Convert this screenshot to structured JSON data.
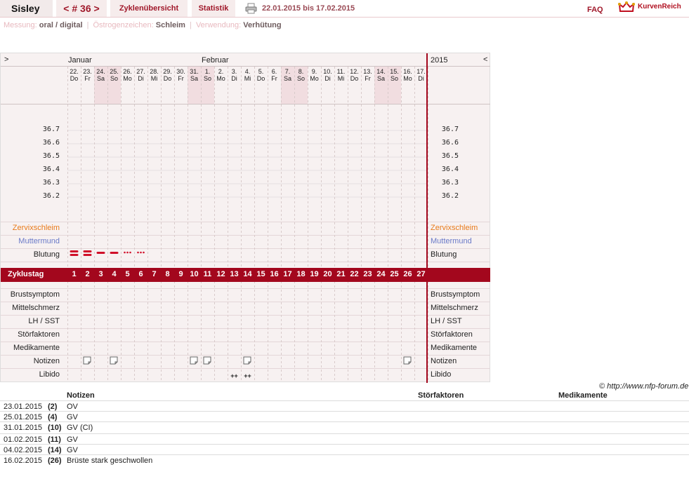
{
  "header": {
    "user": "Sisley",
    "cycle_nav": "< # 36 >",
    "tab_overview": "Zyklenübersicht",
    "tab_stats": "Statistik",
    "date_range": "22.01.2015 bis 17.02.2015",
    "faq": "FAQ",
    "logo_text": "KurvenReich"
  },
  "meta": {
    "messung_label": "Messung:",
    "messung_value": "oral / digital",
    "oestro_label": "Östrogenzeichen:",
    "oestro_value": "Schleim",
    "verwendung_label": "Verwendung:",
    "verwendung_value": "Verhütung"
  },
  "chart": {
    "nav_left": ">",
    "nav_right": "<",
    "year": "2015",
    "month_jan": "Januar",
    "month_feb": "Februar",
    "days": [
      {
        "d": "22.",
        "w": "Do",
        "we": false
      },
      {
        "d": "23.",
        "w": "Fr",
        "we": false
      },
      {
        "d": "24.",
        "w": "Sa",
        "we": true
      },
      {
        "d": "25.",
        "w": "So",
        "we": true
      },
      {
        "d": "26.",
        "w": "Mo",
        "we": false
      },
      {
        "d": "27.",
        "w": "Di",
        "we": false
      },
      {
        "d": "28.",
        "w": "Mi",
        "we": false
      },
      {
        "d": "29.",
        "w": "Do",
        "we": false
      },
      {
        "d": "30.",
        "w": "Fr",
        "we": false
      },
      {
        "d": "31.",
        "w": "Sa",
        "we": true
      },
      {
        "d": "1.",
        "w": "So",
        "we": true
      },
      {
        "d": "2.",
        "w": "Mo",
        "we": false
      },
      {
        "d": "3.",
        "w": "Di",
        "we": false
      },
      {
        "d": "4.",
        "w": "Mi",
        "we": false
      },
      {
        "d": "5.",
        "w": "Do",
        "we": false
      },
      {
        "d": "6.",
        "w": "Fr",
        "we": false
      },
      {
        "d": "7.",
        "w": "Sa",
        "we": true
      },
      {
        "d": "8.",
        "w": "So",
        "we": true
      },
      {
        "d": "9.",
        "w": "Mo",
        "we": false
      },
      {
        "d": "10.",
        "w": "Di",
        "we": false
      },
      {
        "d": "11.",
        "w": "Mi",
        "we": false
      },
      {
        "d": "12.",
        "w": "Do",
        "we": false
      },
      {
        "d": "13.",
        "w": "Fr",
        "we": false
      },
      {
        "d": "14.",
        "w": "Sa",
        "we": true
      },
      {
        "d": "15.",
        "w": "So",
        "we": true
      },
      {
        "d": "16.",
        "w": "Mo",
        "we": false
      },
      {
        "d": "17.",
        "w": "Di",
        "we": false
      }
    ],
    "temps": [
      "36.7",
      "36.6",
      "36.5",
      "36.4",
      "36.3",
      "36.2"
    ],
    "label_zervix": "Zervixschleim",
    "label_muttermund": "Muttermund",
    "label_blutung": "Blutung",
    "label_zyklustag": "Zyklustag",
    "label_brust": "Brustsymptom",
    "label_mittel": "Mittelschmerz",
    "label_lh": "LH / SST",
    "label_stoer": "Störfaktoren",
    "label_medi": "Medikamente",
    "label_notizen": "Notizen",
    "label_libido": "Libido",
    "bleeding": [
      "heavy",
      "heavy",
      "medium",
      "medium",
      "spotting",
      "spotting"
    ],
    "note_days": [
      2,
      4,
      10,
      11,
      14,
      26
    ],
    "libido_days": [
      13,
      14
    ],
    "libido_mark": "++"
  },
  "copyright": "© http://www.nfp-forum.de",
  "notes_table": {
    "h_notizen": "Notizen",
    "h_stoer": "Störfaktoren",
    "h_medi": "Medikamente",
    "rows": [
      {
        "date": "23.01.2015",
        "day": "(2)",
        "note": "OV"
      },
      {
        "date": "25.01.2015",
        "day": "(4)",
        "note": "GV"
      },
      {
        "date": "31.01.2015",
        "day": "(10)",
        "note": "GV (CI)"
      },
      {
        "date": "01.02.2015",
        "day": "(11)",
        "note": "GV"
      },
      {
        "date": "04.02.2015",
        "day": "(14)",
        "note": "GV"
      },
      {
        "date": "16.02.2015",
        "day": "(26)",
        "note": "Brüste stark geschwollen"
      }
    ]
  }
}
